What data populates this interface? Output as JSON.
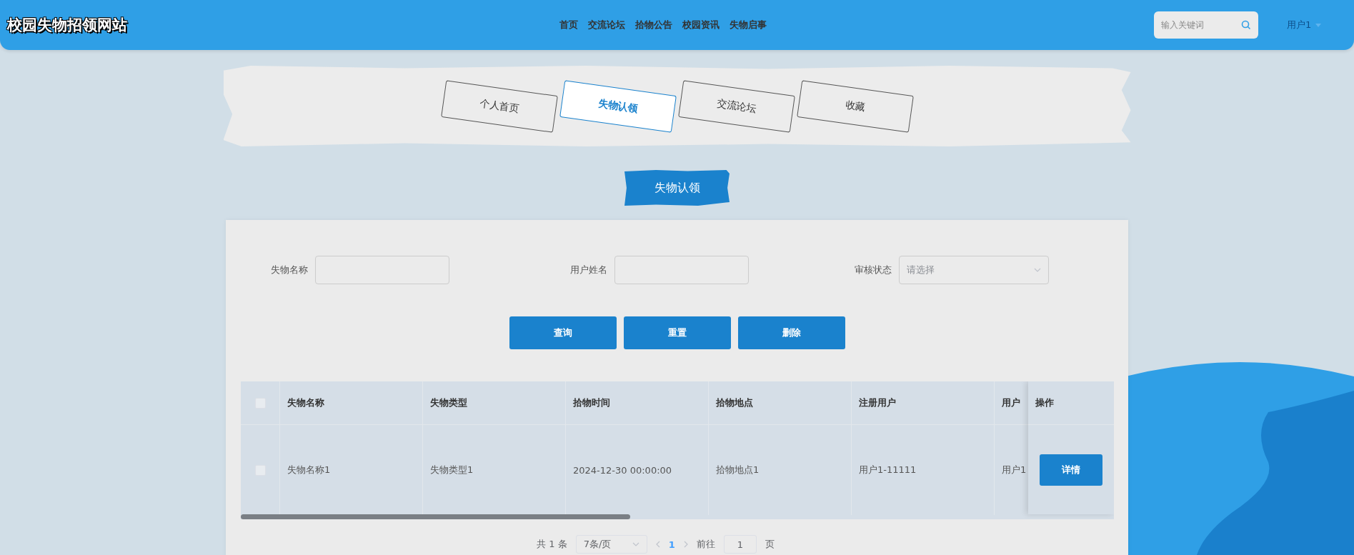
{
  "site_title": "校园失物招领网站",
  "nav": [
    "首页",
    "交流论坛",
    "拾物公告",
    "校园资讯",
    "失物启事"
  ],
  "search": {
    "placeholder": "输入关键词"
  },
  "user_menu": {
    "label": "用户1"
  },
  "tabs": [
    {
      "label": "个人首页",
      "selected": false
    },
    {
      "label": "失物认领",
      "selected": true
    },
    {
      "label": "交流论坛",
      "selected": false
    },
    {
      "label": "收藏",
      "selected": false
    }
  ],
  "section_title": "失物认领",
  "filters": [
    {
      "kind": "text",
      "label": "失物名称"
    },
    {
      "kind": "text",
      "label": "用户姓名"
    },
    {
      "kind": "select",
      "label": "审核状态",
      "placeholder": "请选择"
    }
  ],
  "buttons": [
    "查询",
    "重置",
    "删除"
  ],
  "table": {
    "columns": [
      "失物名称",
      "失物类型",
      "拾物时间",
      "拾物地点",
      "注册用户",
      "用户"
    ],
    "action_column": "操作",
    "select_all_checked": false,
    "rows": [
      {
        "checked": false,
        "cells": [
          "失物名称1",
          "失物类型1",
          "2024-12-30 00:00:00",
          "拾物地点1",
          "用户1-11111",
          "用户1"
        ],
        "action": "详情"
      }
    ]
  },
  "pagination": {
    "total": "共 1 条",
    "page_size": "7条/页",
    "pages": [
      {
        "label": "1",
        "selected": true
      }
    ],
    "goto_label": "前往",
    "goto_value": "1",
    "goto_suffix": "页"
  }
}
